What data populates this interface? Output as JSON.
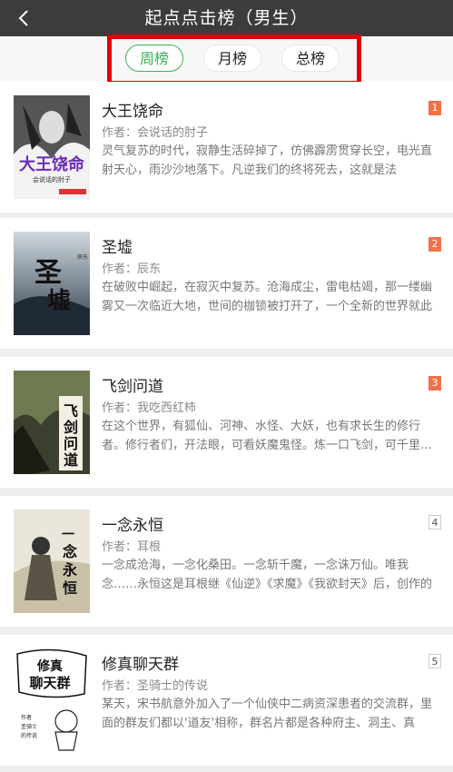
{
  "header": {
    "title": "起点点击榜（男生）",
    "back_icon": "chevron-left-icon"
  },
  "tabs": [
    {
      "label": "周榜",
      "active": true
    },
    {
      "label": "月榜",
      "active": false
    },
    {
      "label": "总榜",
      "active": false
    }
  ],
  "colors": {
    "accent": "#3bb35a",
    "rank_hot": "#f4704a",
    "highlight": "#e00000"
  },
  "books": [
    {
      "rank": "1",
      "title": "大王饶命",
      "author": "作者：会说话的肘子",
      "desc": "灵气复苏的时代，寂静生活碎掉了，仿佛霹雳贯穿长空，电光直射天心，雨沙沙地落下。凡逆我们的终将死去，这就是法则。……这...",
      "cover_text": "大王饶命",
      "cover_sub": "会说话的肘子"
    },
    {
      "rank": "2",
      "title": "圣墟",
      "author": "作者：辰东",
      "desc": "在破败中崛起，在寂灭中复苏。沧海成尘，雷电枯竭，那一缕幽雾又一次临近大地，世间的枷锁被打开了，一个全新的世界就此揭...",
      "cover_text": "圣墟",
      "cover_sub": "辰东"
    },
    {
      "rank": "3",
      "title": "飞剑问道",
      "author": "作者：我吃西红柿",
      "desc": "在这个世界，有狐仙、河神、水怪、大妖，也有求长生的修行者。修行者们，开法眼，可看妖魔鬼怪。炼一口飞剑，可千里...",
      "cover_text": "飞剑问道",
      "cover_sub": "我吃西红柿"
    },
    {
      "rank": "4",
      "title": "一念永恒",
      "author": "作者：耳根",
      "desc": "一念成沧海，一念化桑田。一念斩千魔，一念诛万仙。唯我念……永恒这是耳根继《仙逆》《求魔》《我欲封天》后，创作的第四部...",
      "cover_text": "一念永恒",
      "cover_sub": "耳根"
    },
    {
      "rank": "5",
      "title": "修真聊天群",
      "author": "作者：圣骑士的传说",
      "desc": "某天，宋书航意外加入了一个仙侠中二病资深患者的交流群，里面的群友们都以'道友'相称，群名片都是各种府主、洞主、真人、...",
      "cover_text": "修真聊天群",
      "cover_sub": "圣骑士的传说"
    }
  ]
}
